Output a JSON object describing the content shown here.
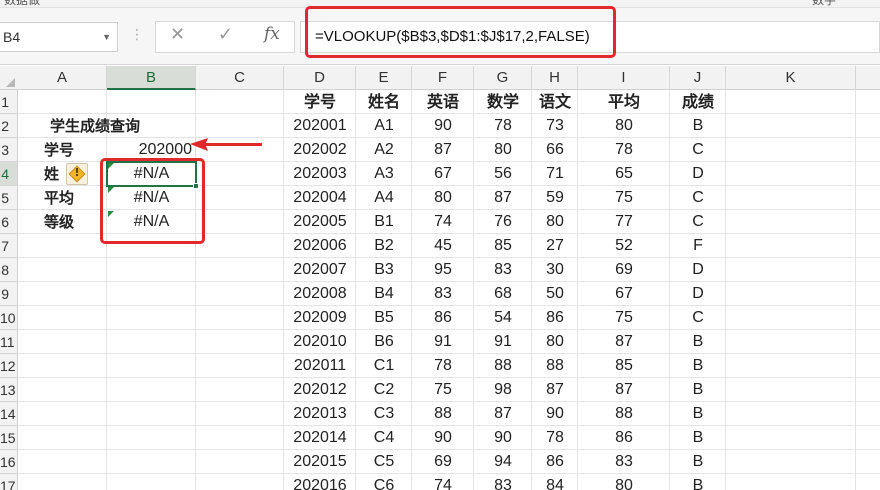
{
  "ribbon": {
    "fragments": [
      "数据做",
      "",
      "",
      "",
      "",
      "",
      "",
      "",
      "数字"
    ]
  },
  "formula_bar": {
    "name_box": "B4",
    "icons": [
      "dots-icon",
      "cancel-x-icon",
      "confirm-check-icon",
      "fx-icon"
    ],
    "formula": "=VLOOKUP($B$3,$D$1:$J$17,2,FALSE)",
    "highlight_color": "#e0292c"
  },
  "columns": [
    "A",
    "B",
    "C",
    "D",
    "E",
    "F",
    "G",
    "H",
    "I",
    "J",
    "K"
  ],
  "rows": [
    "1",
    "2",
    "3",
    "4",
    "5",
    "6",
    "7",
    "8",
    "9",
    "10",
    "11",
    "12",
    "13",
    "14",
    "15",
    "16",
    "17"
  ],
  "selected": {
    "column": "B",
    "row": "4"
  },
  "lookup": {
    "title": "学生成绩查询",
    "labels": [
      "学号",
      "姓",
      "平均",
      "等级"
    ],
    "student_id": "202000",
    "results": [
      "#N/A",
      "#N/A",
      "#N/A"
    ]
  },
  "table": {
    "headers": [
      "学号",
      "姓名",
      "英语",
      "数学",
      "语文",
      "平均",
      "成绩"
    ],
    "rows": [
      [
        "202001",
        "A1",
        "90",
        "78",
        "73",
        "80",
        "B"
      ],
      [
        "202002",
        "A2",
        "87",
        "80",
        "66",
        "78",
        "C"
      ],
      [
        "202003",
        "A3",
        "67",
        "56",
        "71",
        "65",
        "D"
      ],
      [
        "202004",
        "A4",
        "80",
        "87",
        "59",
        "75",
        "C"
      ],
      [
        "202005",
        "B1",
        "74",
        "76",
        "80",
        "77",
        "C"
      ],
      [
        "202006",
        "B2",
        "45",
        "85",
        "27",
        "52",
        "F"
      ],
      [
        "202007",
        "B3",
        "95",
        "83",
        "30",
        "69",
        "D"
      ],
      [
        "202008",
        "B4",
        "83",
        "68",
        "50",
        "67",
        "D"
      ],
      [
        "202009",
        "B5",
        "86",
        "54",
        "86",
        "75",
        "C"
      ],
      [
        "202010",
        "B6",
        "91",
        "91",
        "80",
        "87",
        "B"
      ],
      [
        "202011",
        "C1",
        "78",
        "88",
        "88",
        "85",
        "B"
      ],
      [
        "202012",
        "C2",
        "75",
        "98",
        "87",
        "87",
        "B"
      ],
      [
        "202013",
        "C3",
        "88",
        "87",
        "90",
        "88",
        "B"
      ],
      [
        "202014",
        "C4",
        "90",
        "90",
        "78",
        "86",
        "B"
      ],
      [
        "202015",
        "C5",
        "69",
        "94",
        "86",
        "83",
        "B"
      ],
      [
        "202016",
        "C6",
        "74",
        "83",
        "84",
        "80",
        "B"
      ]
    ]
  },
  "colors": {
    "accent_green": "#217346",
    "annotation_red": "#e0292c",
    "error_indicator": "#2e8b3c",
    "warning": "#f0b429"
  }
}
